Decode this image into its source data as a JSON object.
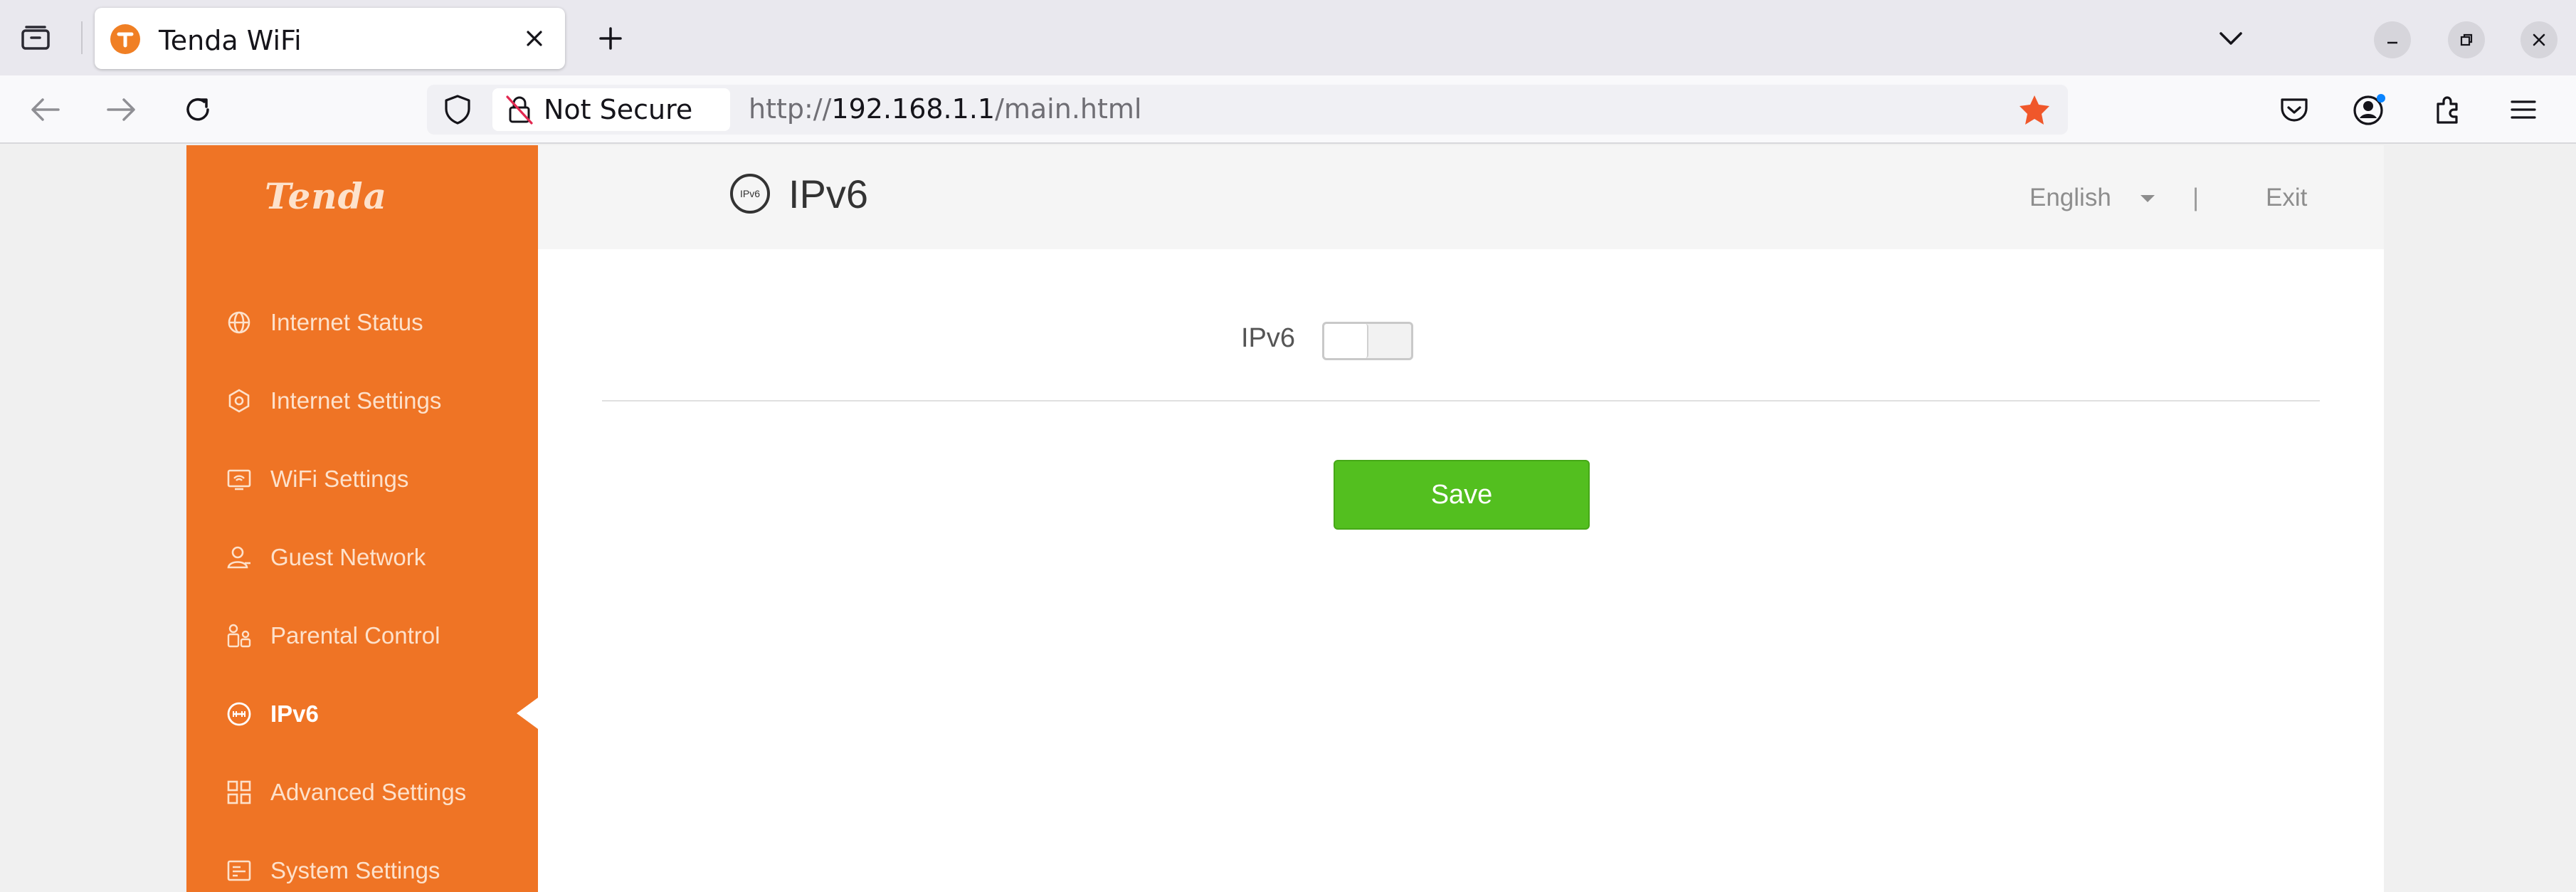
{
  "browser": {
    "tab": {
      "title": "Tenda WiFi",
      "favicon": "tenda-favicon-icon"
    },
    "urlbar": {
      "security_label": "Not Secure",
      "url_scheme": "http://",
      "url_host": "192.168.1.1",
      "url_path": "/main.html"
    }
  },
  "sidebar": {
    "brand": "Tenda",
    "items": [
      {
        "label": "Internet Status",
        "icon": "globe-icon"
      },
      {
        "label": "Internet Settings",
        "icon": "internet-settings-icon"
      },
      {
        "label": "WiFi Settings",
        "icon": "wifi-settings-icon"
      },
      {
        "label": "Guest Network",
        "icon": "guest-user-icon"
      },
      {
        "label": "Parental Control",
        "icon": "parental-control-icon"
      },
      {
        "label": "IPv6",
        "icon": "ipv6-icon",
        "active": true
      },
      {
        "label": "Advanced Settings",
        "icon": "advanced-grid-icon"
      },
      {
        "label": "System Settings",
        "icon": "system-settings-icon"
      }
    ]
  },
  "header": {
    "title": "IPv6",
    "icon_text": "IPv6",
    "language": "English",
    "separator": "|",
    "exit": "Exit"
  },
  "form": {
    "ipv6_label": "IPv6",
    "ipv6_enabled": false,
    "save_label": "Save"
  },
  "colors": {
    "sidebar": "#ef7425",
    "save_button": "#53bf1f",
    "bookmark_star": "#f0572a"
  }
}
